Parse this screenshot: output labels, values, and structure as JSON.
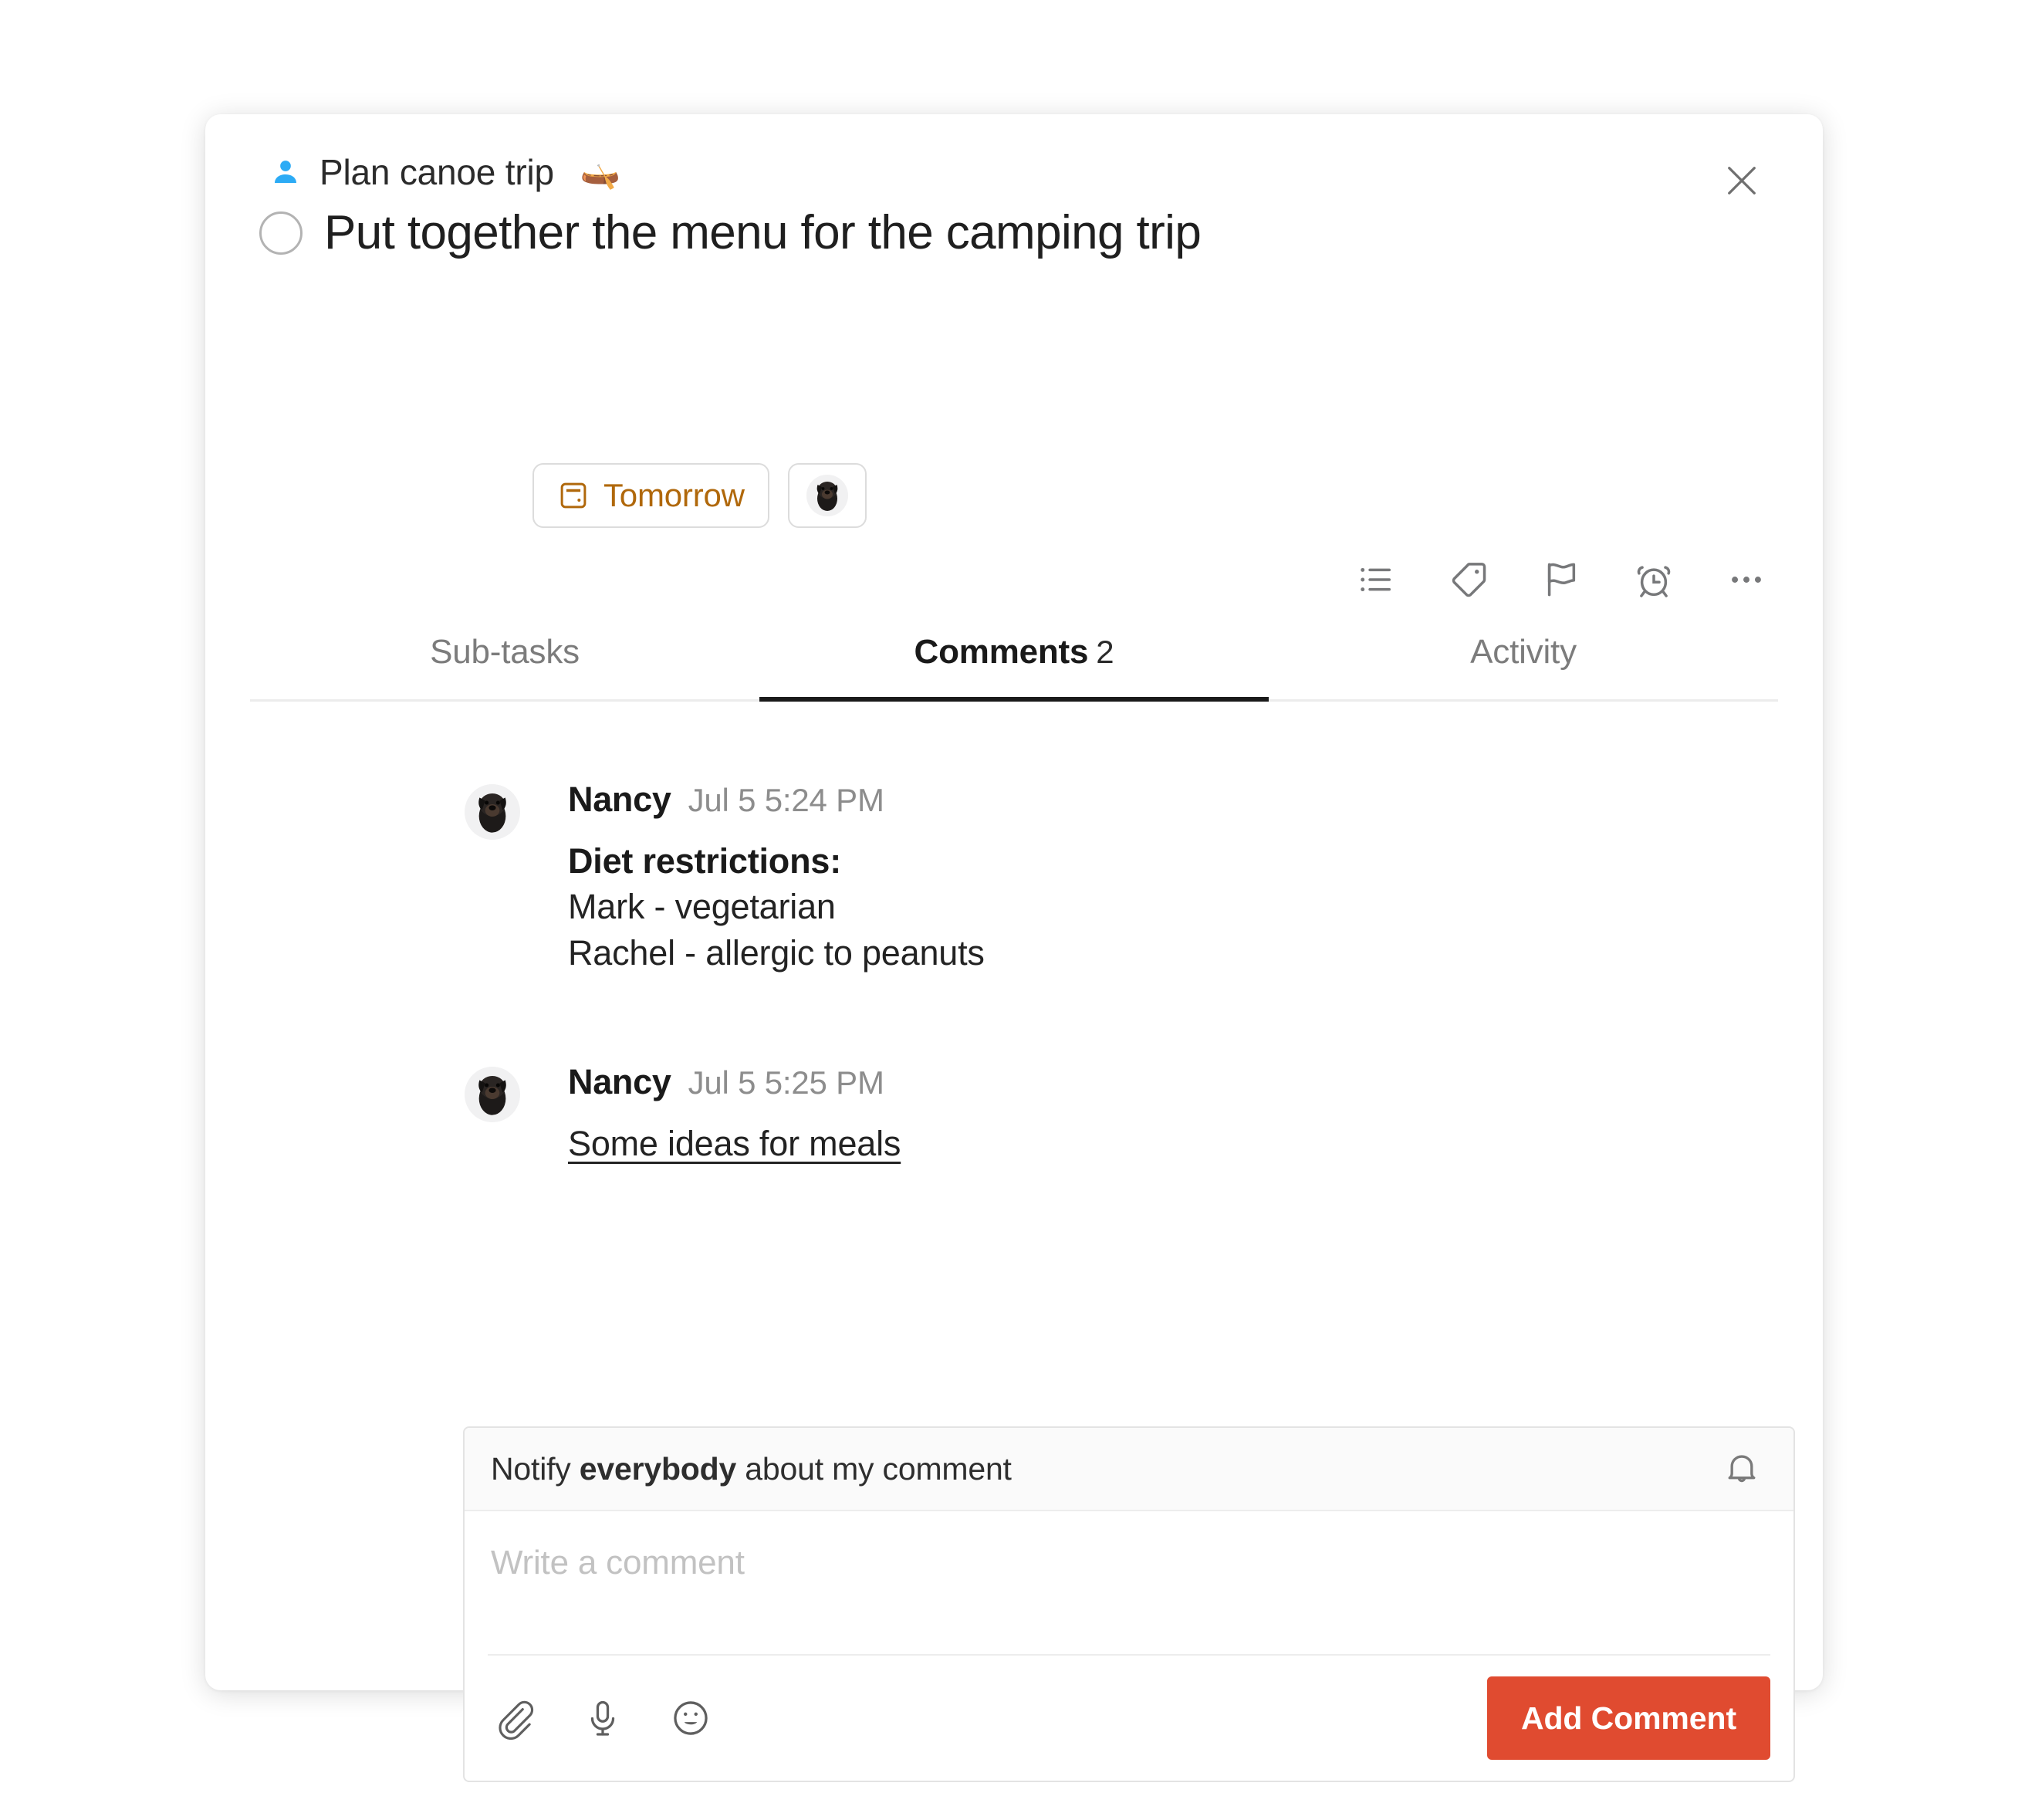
{
  "colors": {
    "accent_button": "#e04b30",
    "due_date": "#b0680b",
    "person_icon": "#2cabf5",
    "active_tab": "#1a1a1a"
  },
  "header": {
    "breadcrumb_project": "Plan canoe trip",
    "breadcrumb_emoji": "🛶",
    "person_icon": "person-icon",
    "close_icon": "close-icon"
  },
  "task": {
    "title": "Put together the menu for the camping trip",
    "checkbox_state": "unchecked",
    "due_date_label": "Tomorrow",
    "due_date_icon": "calendar-icon",
    "assignee_avatar": "pug-avatar"
  },
  "actions": [
    {
      "name": "subtask-list-icon",
      "label": "Sub-tasks"
    },
    {
      "name": "tag-icon",
      "label": "Tags"
    },
    {
      "name": "flag-icon",
      "label": "Priority"
    },
    {
      "name": "alarm-clock-icon",
      "label": "Reminder"
    },
    {
      "name": "more-options-icon",
      "label": "More"
    }
  ],
  "tabs": [
    {
      "label": "Sub-tasks",
      "count": "",
      "active": false
    },
    {
      "label": "Comments",
      "count": "2",
      "active": true
    },
    {
      "label": "Activity",
      "count": "",
      "active": false
    }
  ],
  "comments": [
    {
      "author": "Nancy",
      "time": "Jul 5 5:24 PM",
      "avatar": "pug-avatar",
      "lines": [
        {
          "text": "Diet restrictions:",
          "style": "bold"
        },
        {
          "text": "Mark - vegetarian",
          "style": "plain"
        },
        {
          "text": "Rachel - allergic to peanuts",
          "style": "plain"
        }
      ]
    },
    {
      "author": "Nancy",
      "time": "Jul 5 5:25 PM",
      "avatar": "pug-avatar",
      "lines": [
        {
          "text": "Some ideas for meals",
          "style": "link"
        }
      ]
    }
  ],
  "composer": {
    "notify_prefix": "Notify ",
    "notify_target": "everybody",
    "notify_suffix": " about my comment",
    "bell_icon": "bell-icon",
    "input_value": "",
    "input_placeholder": "Write a comment",
    "tools": [
      {
        "name": "attachment-icon",
        "label": "Attach file"
      },
      {
        "name": "microphone-icon",
        "label": "Record audio"
      },
      {
        "name": "emoji-icon",
        "label": "Emoji"
      }
    ],
    "submit_label": "Add Comment"
  }
}
